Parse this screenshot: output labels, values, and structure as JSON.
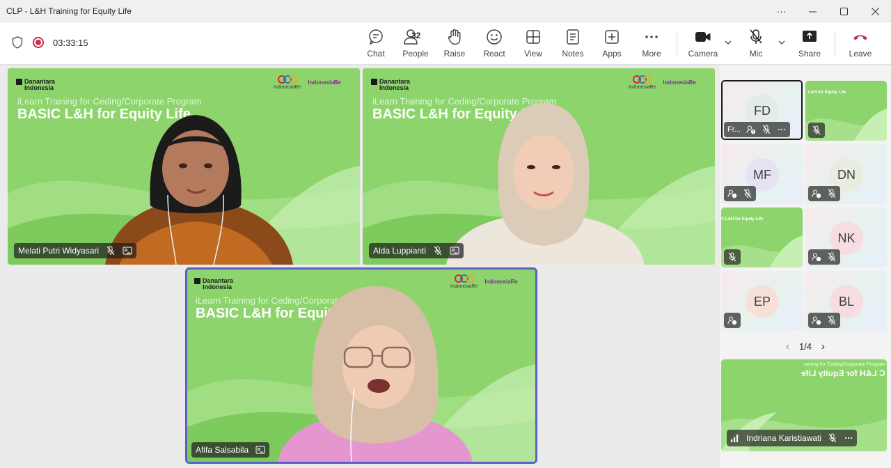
{
  "window": {
    "title": "CLP - L&H Training for Equity Life"
  },
  "meeting": {
    "timer": "03:33:15"
  },
  "toolbar": {
    "chat": "Chat",
    "people": "People",
    "people_count": "32",
    "raise": "Raise",
    "react": "React",
    "view": "View",
    "notes": "Notes",
    "apps": "Apps",
    "more": "More",
    "camera": "Camera",
    "mic": "Mic",
    "share": "Share",
    "leave": "Leave"
  },
  "slide": {
    "brand_left_1": "Danantara",
    "brand_left_2": "Indonesia",
    "brand_right_1": "IndonesiaRe",
    "brand_right_2": "IndonesiaRe",
    "subtitle": "iLearn Training for Ceding/Corporate Program",
    "title": "BASIC L&H for Equity Life"
  },
  "participants": {
    "main": [
      {
        "name": "Melati Putri Widyasari"
      },
      {
        "name": "Alda Luppianti"
      },
      {
        "name": "Afifa Salsabila"
      }
    ],
    "side": [
      {
        "initials": "FD",
        "name": "Fr..."
      },
      {
        "initials": "",
        "slide_text": "L&H for Equity Life"
      },
      {
        "initials": "MF"
      },
      {
        "initials": "DN"
      },
      {
        "initials": "",
        "slide_text": "C L&H for Equity Life"
      },
      {
        "initials": "NK"
      },
      {
        "initials": "EP"
      },
      {
        "initials": "BL"
      }
    ],
    "self_view": {
      "name": "Indriana Karistiawati",
      "mirror_title": "C L&H for Equity Life",
      "mirror_sub": "raining for Ceding/Corporate Program"
    }
  },
  "pager": {
    "label": "1/4"
  },
  "colors": {
    "accent": "#5b5fc7",
    "leave": "#c4314b",
    "slide_green": "#8dd46c",
    "avatar_fd": "#e4ece8",
    "avatar_mf": "#e7e2f3",
    "avatar_dn": "#e9ede0",
    "avatar_nk": "#f6dde2",
    "avatar_ep": "#f6e1d9",
    "avatar_bl": "#f5dde1"
  }
}
